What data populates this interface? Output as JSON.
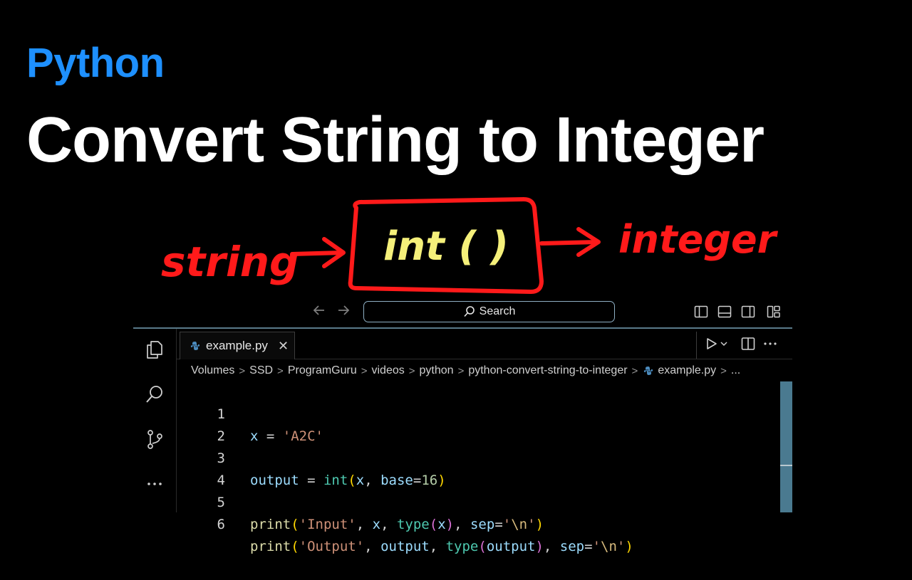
{
  "header": {
    "kicker": "Python",
    "title": "Convert String to Integer"
  },
  "diagram": {
    "input_label": "string",
    "function_label": "int ( )",
    "output_label": "integer",
    "colors": {
      "ink": "#ff1a1a",
      "function_text": "#f5f07a"
    }
  },
  "titlebar": {
    "back_icon": "arrow-left-icon",
    "forward_icon": "arrow-right-icon",
    "search_placeholder": "Search"
  },
  "tab": {
    "label": "example.py",
    "close": "✕"
  },
  "breadcrumb": [
    "Volumes",
    "SSD",
    "ProgramGuru",
    "videos",
    "python",
    "python-convert-string-to-integer",
    "example.py",
    "..."
  ],
  "code": [
    {
      "n": "1",
      "text": "x = 'A2C'"
    },
    {
      "n": "2",
      "text": ""
    },
    {
      "n": "3",
      "text": "output = int(x, base=16)"
    },
    {
      "n": "4",
      "text": ""
    },
    {
      "n": "5",
      "text": "print('Input', x, type(x), sep='\\n')"
    },
    {
      "n": "6",
      "text": "print('Output', output, type(output), sep='\\n')"
    }
  ],
  "colors": {
    "kicker": "#1e90ff",
    "background": "#000000",
    "scrollbar": "#4a7a90"
  }
}
